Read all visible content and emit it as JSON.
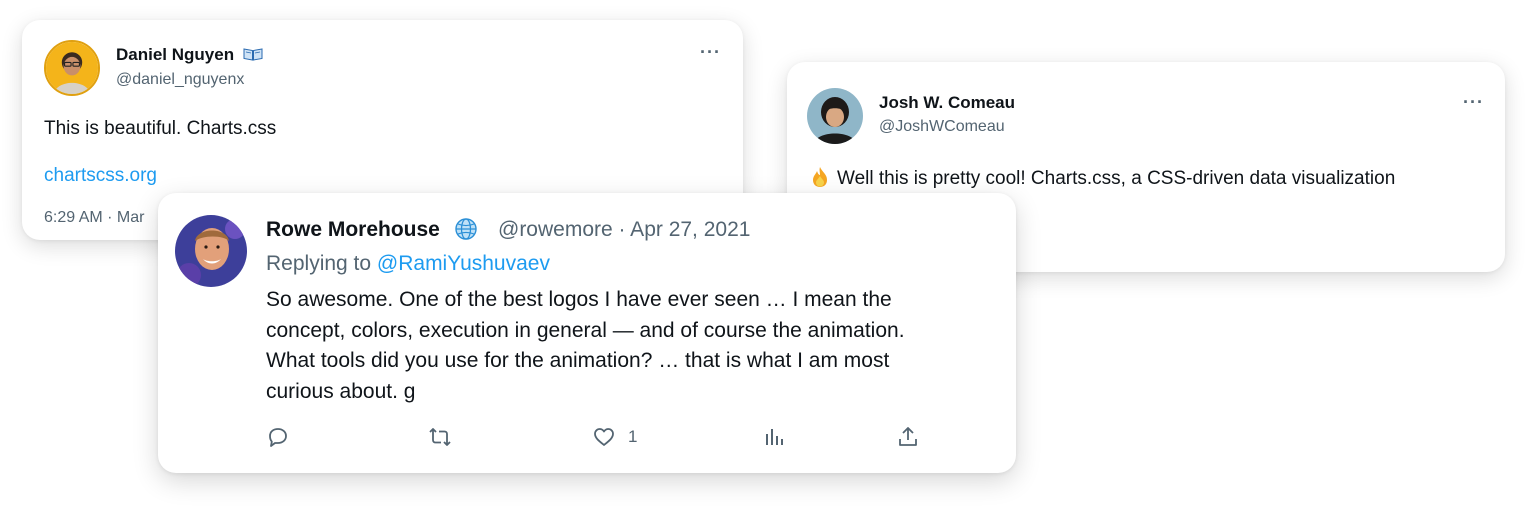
{
  "tweets": {
    "daniel": {
      "name": "Daniel Nguyen",
      "badge_icon": "open-book-icon",
      "handle": "@daniel_nguyenx",
      "text": "This is beautiful. Charts.css",
      "link": "chartscss.org",
      "meta": "6:29 AM · Mar"
    },
    "josh": {
      "name": "Josh W. Comeau",
      "handle": "@JoshWComeau",
      "emoji_icon": "fire-icon",
      "text": "Well this is pretty cool! Charts.css, a CSS-driven data visualization"
    },
    "rowe": {
      "name": "Rowe Morehouse",
      "badge_icon": "globe-icon",
      "handle_date": "@rowemore · Apr 27, 2021",
      "replying_to_label": "Replying to",
      "replying_to_handle": "@RamiYushuvaev",
      "body_lines": [
        "So awesome. One of the best logos I have ever seen … I mean the",
        "concept, colors, execution in general — and of course the animation.",
        "What tools did you use for the animation? … that is what I am most",
        "curious about. g"
      ],
      "actions": {
        "reply_icon": "reply-icon",
        "retweet_icon": "retweet-icon",
        "like_icon": "heart-icon",
        "like_count": "1",
        "views_icon": "analytics-icon",
        "share_icon": "share-icon"
      }
    }
  },
  "more_label": "···",
  "colors": {
    "link": "#1d9bf0",
    "secondary_text": "#536471",
    "primary_text": "#0f1419"
  }
}
